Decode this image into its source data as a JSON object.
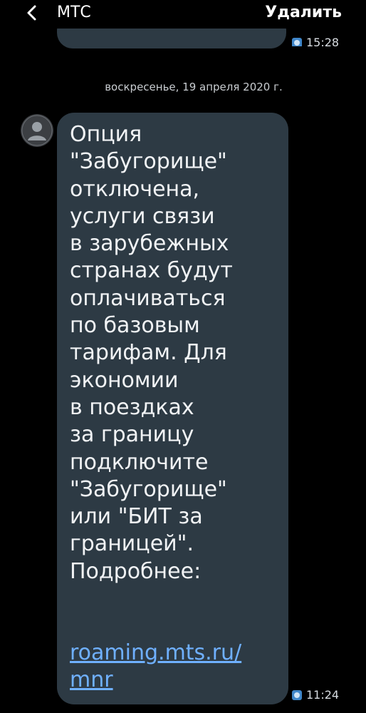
{
  "header": {
    "title": "МТС",
    "delete_label": "Удалить"
  },
  "previous_message": {
    "time": "15:28"
  },
  "date_separator": "воскресенье, 19 апреля 2020 г.",
  "message": {
    "text": "Опция\n\"Забугорище\"\nотключена,\nуслуги связи\nв зарубежных\nстранах будут\nоплачиваться\nпо базовым\nтарифам. Для\nэкономии\nв поездках\nза границу\nподключите\n\"Забугорище\"\nили \"БИТ за\nграницей\".\nПодробнее:",
    "link": "roaming.mts.ru/\nmnr",
    "time": "11:24"
  },
  "colors": {
    "background": "#000000",
    "bubble": "#2d3a44",
    "link": "#6fb0ff",
    "sim_icon": "#3f86c9"
  },
  "icons": {
    "back": "chevron-left-icon",
    "avatar": "person-icon",
    "sim": "sim-icon"
  }
}
